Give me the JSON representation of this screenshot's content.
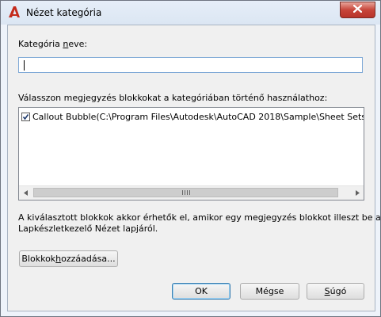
{
  "window": {
    "title": "Nézet kategória",
    "close_icon": "close-icon",
    "app_icon": "autocad-a-icon",
    "accent": "#c42b1c"
  },
  "category_name": {
    "label_before": "Kategória ",
    "label_mnemonic": "n",
    "label_after": "eve:",
    "value": ""
  },
  "blocks": {
    "label": "Válasszon megjegyzés blokkokat a kategóriában történő használathoz:",
    "items": [
      {
        "checked": true,
        "text": "Callout Bubble(C:\\Program Files\\Autodesk\\AutoCAD 2018\\Sample\\Sheet Sets\\Architectural\\Resources\\Callouts.dwg)"
      }
    ]
  },
  "info": {
    "line1": "A kiválasztott blokkok akkor érhetők el, amikor egy megjegyzés blokkot illeszt be a",
    "line2": "Lapkészletkezelő Nézet lapjáról."
  },
  "buttons": {
    "add_blocks_before": "Blokkok ",
    "add_blocks_mnemonic": "h",
    "add_blocks_after": "ozzáadása...",
    "ok": "OK",
    "cancel": "Mégse",
    "help_mnemonic": "S",
    "help_after": "úgó"
  }
}
